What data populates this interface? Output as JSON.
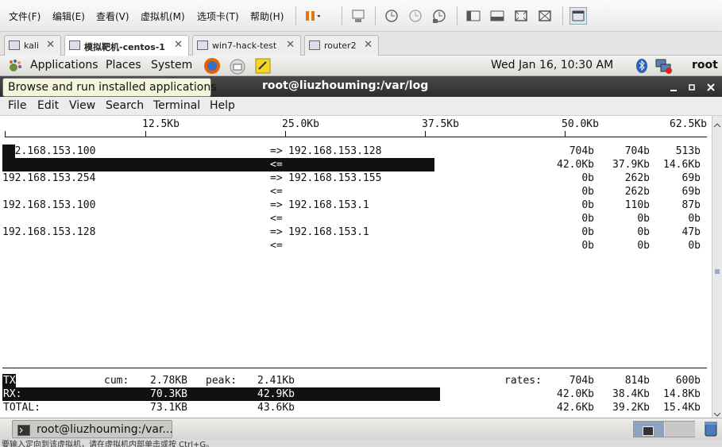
{
  "vmware": {
    "menu": [
      "文件(F)",
      "编辑(E)",
      "查看(V)",
      "虚拟机(M)",
      "选项卡(T)",
      "帮助(H)"
    ],
    "tabs": [
      {
        "label": "kali"
      },
      {
        "label": "模拟靶机-centos-1"
      },
      {
        "label": "win7-hack-test"
      },
      {
        "label": "router2"
      }
    ],
    "close_glyph": "✕"
  },
  "panel": {
    "applications": "Applications",
    "places": "Places",
    "system": "System",
    "clock": "Wed Jan 16, 10:30 AM",
    "user": "root"
  },
  "tooltip": "Browse and run installed applications",
  "terminal": {
    "title": "root@liuzhouming:/var/log",
    "menu": [
      "File",
      "Edit",
      "View",
      "Search",
      "Terminal",
      "Help"
    ],
    "scale": [
      "12.5Kb",
      "25.0Kb",
      "37.5Kb",
      "50.0Kb",
      "62.5Kb"
    ],
    "flows": [
      {
        "src": "192.168.153.100",
        "dst": "192.168.153.128",
        "out": [
          "704b",
          "704b",
          "513b"
        ],
        "in": [
          "42.0Kb",
          "37.9Kb",
          "14.6Kb"
        ]
      },
      {
        "src": "192.168.153.254",
        "dst": "192.168.153.155",
        "out": [
          "0b",
          "262b",
          "69b"
        ],
        "in": [
          "0b",
          "262b",
          "69b"
        ]
      },
      {
        "src": "192.168.153.100",
        "dst": "192.168.153.1",
        "out": [
          "0b",
          "110b",
          "87b"
        ],
        "in": [
          "0b",
          "0b",
          "0b"
        ]
      },
      {
        "src": "192.168.153.128",
        "dst": "192.168.153.1",
        "out": [
          "0b",
          "0b",
          "47b"
        ],
        "in": [
          "0b",
          "0b",
          "0b"
        ]
      }
    ],
    "arrow_out": "=>",
    "arrow_in": "<=",
    "summary": {
      "tx": {
        "label": "TX:",
        "cum_label": "cum:",
        "cum": "2.78KB",
        "peak_label": "peak:",
        "peak": "2.41Kb",
        "rates_label": "rates:",
        "rates": [
          "704b",
          "814b",
          "600b"
        ]
      },
      "rx": {
        "label": "RX:",
        "cum": "70.3KB",
        "peak": "42.9Kb",
        "rates": [
          "42.0Kb",
          "38.4Kb",
          "14.8Kb"
        ]
      },
      "total": {
        "label": "TOTAL:",
        "cum": "73.1KB",
        "peak": "43.6Kb",
        "rates": [
          "42.6Kb",
          "39.2Kb",
          "15.4Kb"
        ]
      }
    }
  },
  "taskbar": {
    "window": "root@liuzhouming:/var..."
  },
  "status": "要输入定向到该虚拟机，请在虚拟机内部单击或按 Ctrl+G。"
}
